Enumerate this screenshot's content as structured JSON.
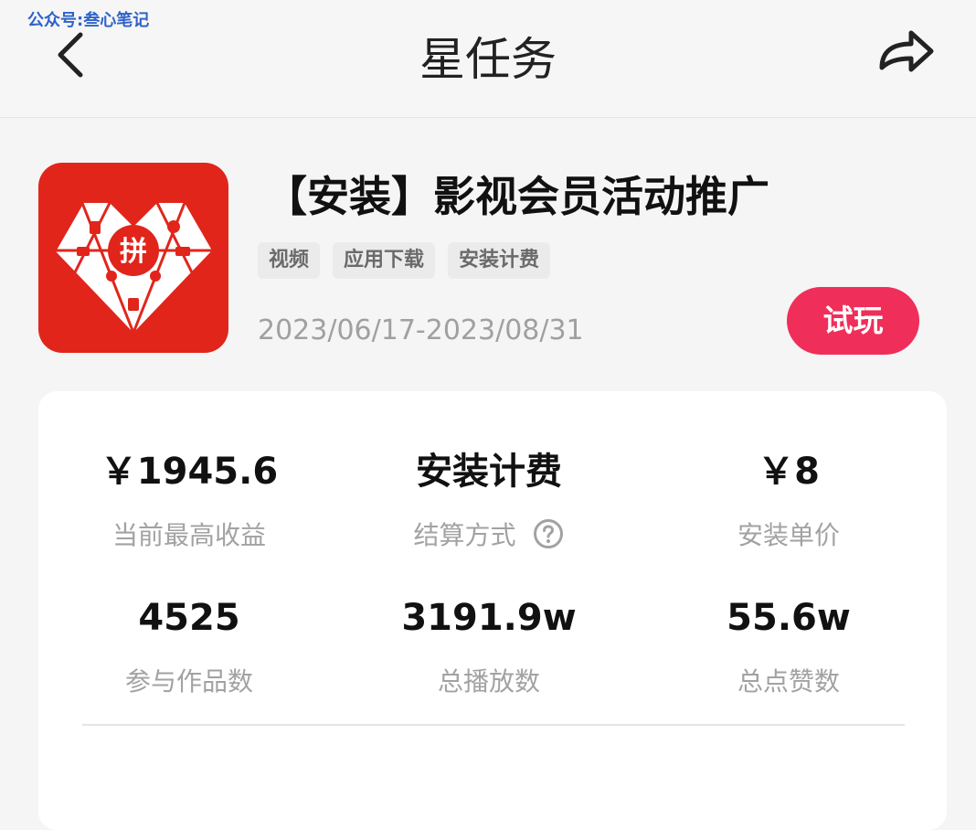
{
  "watermark": "公众号:叁心笔记",
  "header": {
    "title": "星任务"
  },
  "task": {
    "title": "【安装】影视会员活动推广",
    "tags": [
      "视频",
      "应用下载",
      "安装计费"
    ],
    "date_range": "2023/06/17-2023/08/31",
    "try_label": "试玩"
  },
  "icons": {
    "back": "chevron-left-icon",
    "share": "share-arrow-icon",
    "help": "question-circle-icon",
    "app": "pinduoduo-app-icon"
  },
  "colors": {
    "accent": "#f02e5a",
    "app_icon_bg": "#e1251b",
    "label_gray": "#a2a2a2"
  },
  "stats": [
    {
      "value": "￥1945.6",
      "label": "当前最高收益"
    },
    {
      "value": "安装计费",
      "label": "结算方式"
    },
    {
      "value": "￥8",
      "label": "安装单价"
    },
    {
      "value": "4525",
      "label": "参与作品数"
    },
    {
      "value": "3191.9w",
      "label": "总播放数"
    },
    {
      "value": "55.6w",
      "label": "总点赞数"
    }
  ]
}
